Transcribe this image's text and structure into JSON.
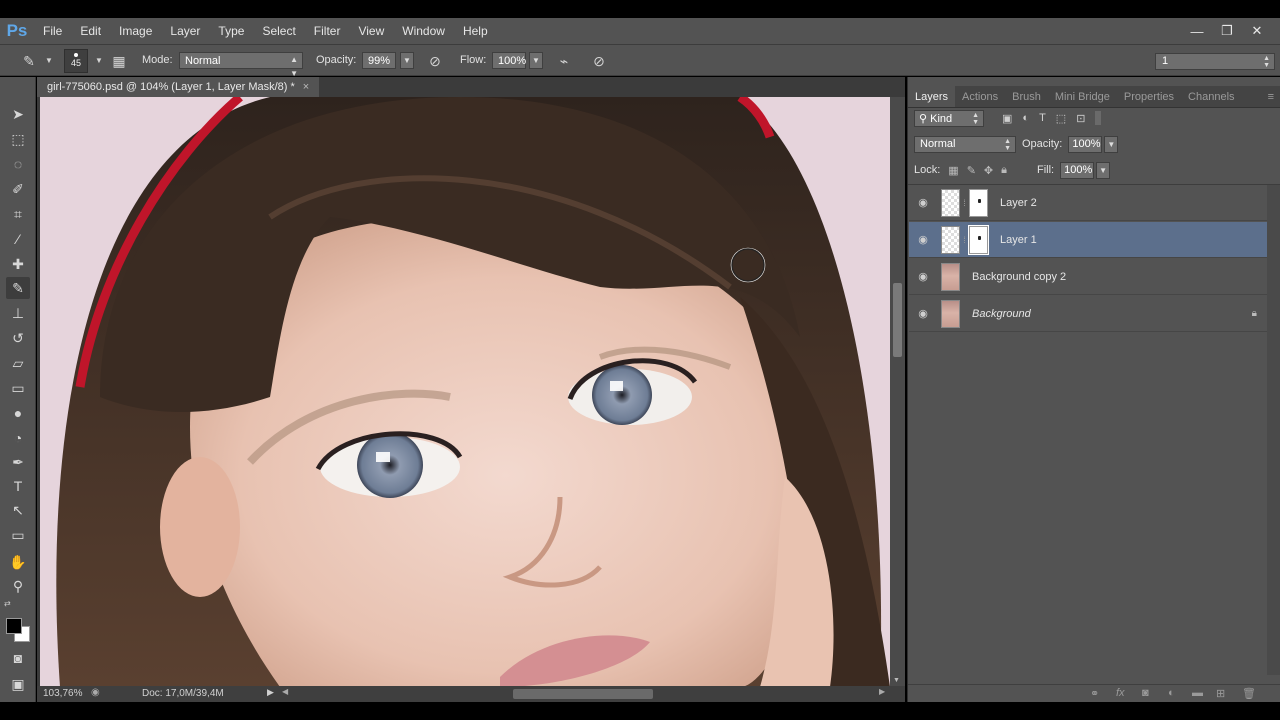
{
  "app": {
    "logo": "Ps"
  },
  "menu": [
    "File",
    "Edit",
    "Image",
    "Layer",
    "Type",
    "Select",
    "Filter",
    "View",
    "Window",
    "Help"
  ],
  "window_controls": {
    "minimize": "—",
    "restore": "❐",
    "close": "✕"
  },
  "options": {
    "brush_size": "45",
    "mode_label": "Mode:",
    "mode_value": "Normal",
    "opacity_label": "Opacity:",
    "opacity_value": "99%",
    "flow_label": "Flow:",
    "flow_value": "100%",
    "right_select_value": "1"
  },
  "document": {
    "tab_title": "girl-775060.psd @ 104% (Layer 1, Layer Mask/8) *",
    "close": "×"
  },
  "status": {
    "zoom": "103,76%",
    "doc": "Doc: 17,0M/39,4M"
  },
  "panel": {
    "tabs": [
      "Layers",
      "Actions",
      "Brush",
      "Mini Bridge",
      "Properties",
      "Channels"
    ],
    "active_tab": "Layers",
    "kind_label": "Kind",
    "blend_mode": "Normal",
    "opacity_label": "Opacity:",
    "opacity_value": "100%",
    "lock_label": "Lock:",
    "fill_label": "Fill:",
    "fill_value": "100%",
    "layers": [
      {
        "name": "Layer 2",
        "has_mask": true,
        "selected": false
      },
      {
        "name": "Layer 1",
        "has_mask": true,
        "selected": true
      },
      {
        "name": "Background copy 2",
        "has_mask": false,
        "selected": false
      },
      {
        "name": "Background",
        "has_mask": false,
        "selected": false,
        "locked": true
      }
    ]
  },
  "colors": {
    "accent_selected": "#5c6f8c",
    "ps_blue": "#5fa7e8",
    "headband": "#c0152a"
  }
}
